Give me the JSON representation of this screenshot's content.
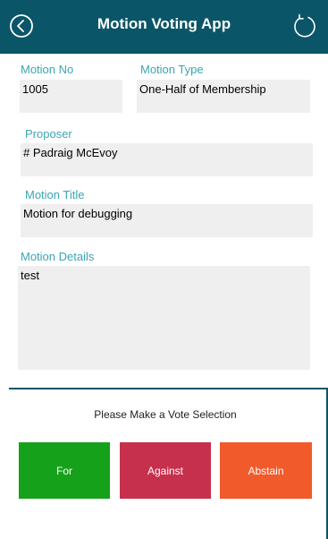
{
  "header": {
    "title": "Motion Voting App",
    "back_icon": "circle-left-arrow",
    "refresh_icon": "circular-refresh-arrow"
  },
  "motion": {
    "number_label": "Motion No",
    "number_value": "1005",
    "type_label": "Motion Type",
    "type_value": "One-Half of Membership",
    "proposer_label": "Proposer",
    "proposer_value": "# Padraig McEvoy",
    "title_label": "Motion Title",
    "title_value": "Motion for debugging",
    "details_label": "Motion Details",
    "details_value": "test"
  },
  "vote": {
    "prompt": "Please Make a Vote Selection",
    "for_label": "For",
    "against_label": "Against",
    "abstain_label": "Abstain"
  },
  "colors": {
    "header_bg": "#0b5568",
    "label_teal": "#3aa6b2",
    "for": "#16a11a",
    "against": "#c6304c",
    "abstain": "#f15a2b"
  }
}
